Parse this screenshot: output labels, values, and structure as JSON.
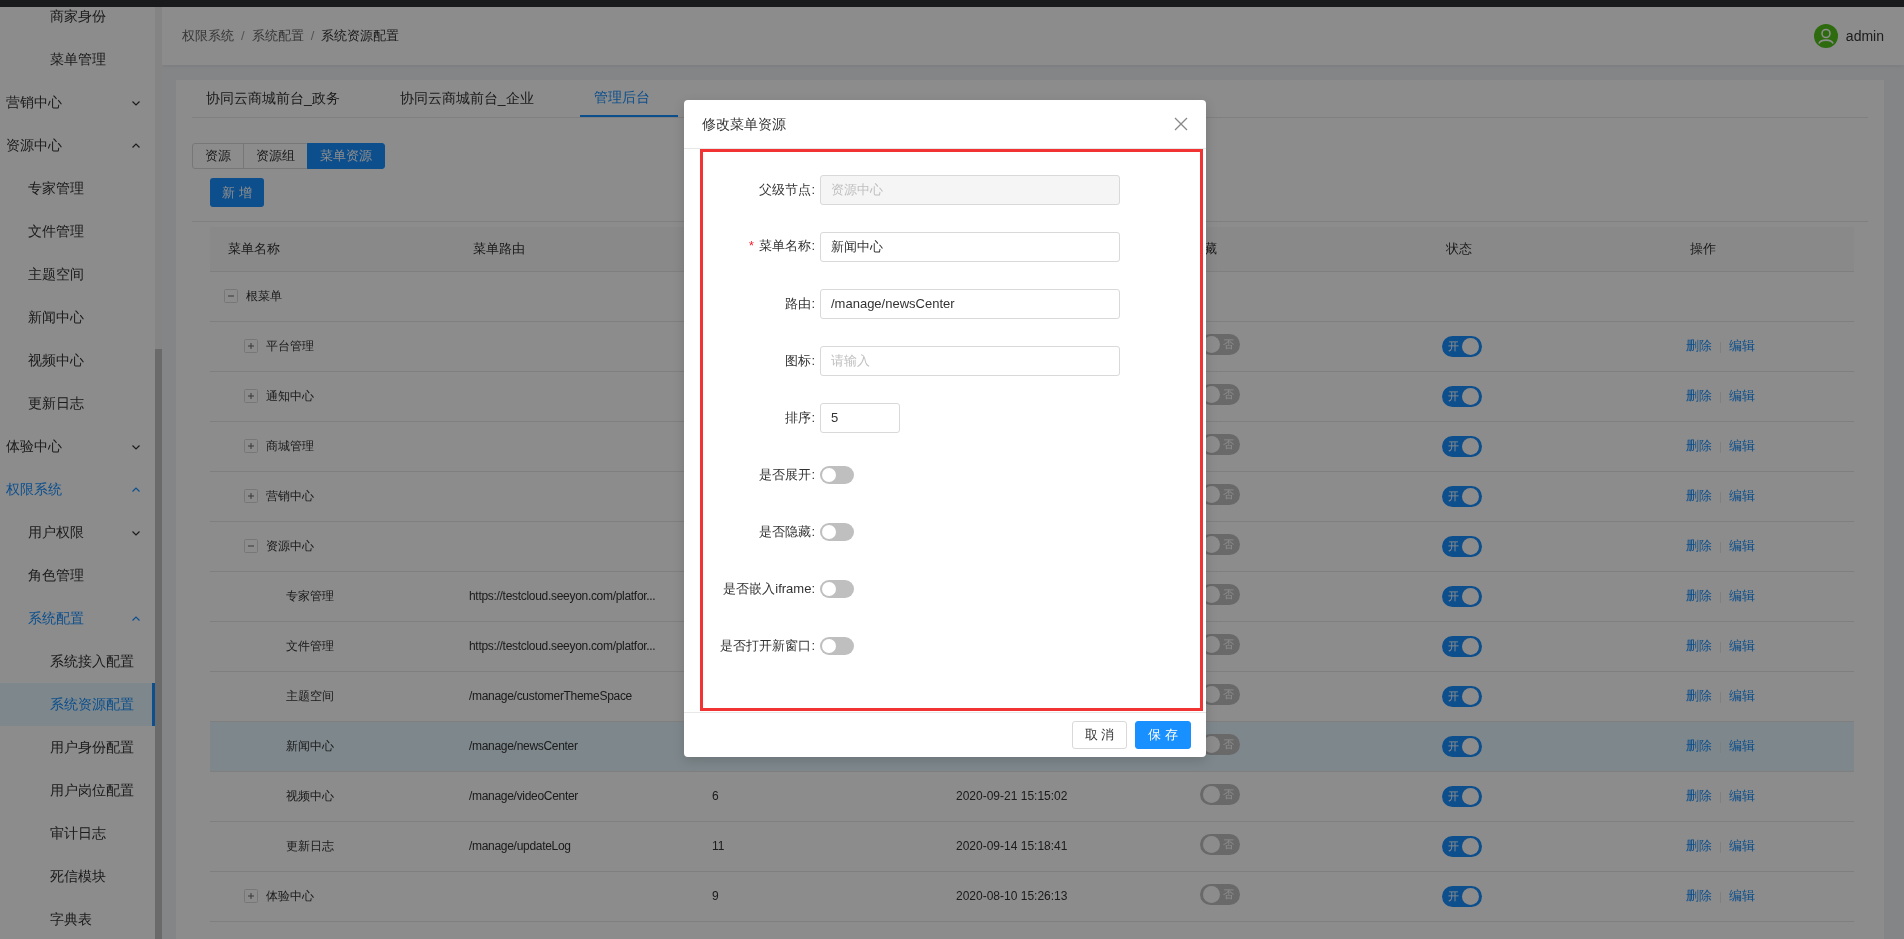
{
  "breadcrumb": {
    "items": [
      "权限系统",
      "系统配置",
      "系统资源配置"
    ],
    "separator": "/"
  },
  "user": {
    "name": "admin"
  },
  "sidebar": {
    "partial_items": [
      {
        "label": "商家身份",
        "selected": false
      },
      {
        "label": "菜单管理",
        "selected": false
      }
    ],
    "items": [
      {
        "label": "营销中心",
        "expanded": false,
        "selected": false
      },
      {
        "label": "资源中心",
        "expanded": true,
        "selected": false,
        "children": [
          {
            "label": "专家管理",
            "selected": false
          },
          {
            "label": "文件管理",
            "selected": false
          },
          {
            "label": "主题空间",
            "selected": false
          },
          {
            "label": "新闻中心",
            "selected": false
          },
          {
            "label": "视频中心",
            "selected": false
          },
          {
            "label": "更新日志",
            "selected": false
          }
        ]
      },
      {
        "label": "体验中心",
        "expanded": false,
        "selected": false
      },
      {
        "label": "权限系统",
        "expanded": true,
        "selected": false,
        "children": [
          {
            "label": "用户权限",
            "expanded": false,
            "selected": false
          },
          {
            "label": "角色管理",
            "selected": false
          },
          {
            "label": "系统配置",
            "expanded": true,
            "selected": false,
            "children": [
              {
                "label": "系统接入配置",
                "selected": false
              },
              {
                "label": "系统资源配置",
                "selected": true
              },
              {
                "label": "用户身份配置",
                "selected": false
              },
              {
                "label": "用户岗位配置",
                "selected": false
              },
              {
                "label": "审计日志",
                "selected": false
              },
              {
                "label": "死信模块",
                "selected": false
              },
              {
                "label": "字典表",
                "selected": false
              }
            ]
          }
        ]
      }
    ]
  },
  "tabs": [
    {
      "label": "协同云商城前台_政务",
      "selected": false
    },
    {
      "label": "协同云商城前台_企业",
      "selected": false
    },
    {
      "label": "管理后台",
      "selected": true
    }
  ],
  "segments": [
    {
      "label": "资源",
      "selected": false
    },
    {
      "label": "资源组",
      "selected": false
    },
    {
      "label": "菜单资源",
      "selected": true
    }
  ],
  "add_button": "新 增",
  "table": {
    "columns": [
      "菜单名称",
      "菜单路由",
      null,
      null,
      "藏",
      "状态",
      "操作"
    ],
    "rows": [
      {
        "name": "根菜单",
        "expanded": true,
        "selected": false,
        "children": [
          {
            "name": "平台管理",
            "expanded": false,
            "selected": false,
            "hidden": {
              "on": false,
              "label": "否"
            },
            "status": {
              "on": true,
              "label": "开"
            },
            "actions": [
              "删除",
              "编辑"
            ]
          },
          {
            "name": "通知中心",
            "expanded": false,
            "selected": false,
            "hidden": {
              "on": false,
              "label": "否"
            },
            "status": {
              "on": true,
              "label": "开"
            },
            "actions": [
              "删除",
              "编辑"
            ]
          },
          {
            "name": "商城管理",
            "expanded": false,
            "selected": false,
            "hidden": {
              "on": false,
              "label": "否"
            },
            "status": {
              "on": true,
              "label": "开"
            },
            "actions": [
              "删除",
              "编辑"
            ]
          },
          {
            "name": "营销中心",
            "expanded": false,
            "selected": false,
            "hidden": {
              "on": false,
              "label": "否"
            },
            "status": {
              "on": true,
              "label": "开"
            },
            "actions": [
              "删除",
              "编辑"
            ]
          },
          {
            "name": "资源中心",
            "expanded": true,
            "selected": false,
            "hidden": {
              "on": false,
              "label": "否"
            },
            "status": {
              "on": true,
              "label": "开"
            },
            "actions": [
              "删除",
              "编辑"
            ],
            "children": [
              {
                "name": "专家管理",
                "route": "https://testcloud.seeyon.com/platfor...",
                "selected": false,
                "hidden": {
                  "on": false,
                  "label": "否"
                },
                "status": {
                  "on": true,
                  "label": "开"
                },
                "actions": [
                  "删除",
                  "编辑"
                ]
              },
              {
                "name": "文件管理",
                "route": "https://testcloud.seeyon.com/platfor...",
                "selected": false,
                "hidden": {
                  "on": false,
                  "label": "否"
                },
                "status": {
                  "on": true,
                  "label": "开"
                },
                "actions": [
                  "删除",
                  "编辑"
                ]
              },
              {
                "name": "主题空间",
                "route": "/manage/customerThemeSpace",
                "selected": false,
                "hidden": {
                  "on": false,
                  "label": "否"
                },
                "status": {
                  "on": true,
                  "label": "开"
                },
                "actions": [
                  "删除",
                  "编辑"
                ]
              },
              {
                "name": "新闻中心",
                "route": "/manage/newsCenter",
                "selected": true,
                "hidden": {
                  "on": false,
                  "label": "否"
                },
                "status": {
                  "on": true,
                  "label": "开"
                },
                "actions": [
                  "删除",
                  "编辑"
                ]
              },
              {
                "name": "视频中心",
                "route": "/manage/videoCenter",
                "sort": "6",
                "time": "2020-09-21 15:15:02",
                "selected": false,
                "hidden": {
                  "on": false,
                  "label": "否"
                },
                "status": {
                  "on": true,
                  "label": "开"
                },
                "actions": [
                  "删除",
                  "编辑"
                ]
              },
              {
                "name": "更新日志",
                "route": "/manage/updateLog",
                "sort": "11",
                "time": "2020-09-14 15:18:41",
                "selected": false,
                "hidden": {
                  "on": false,
                  "label": "否"
                },
                "status": {
                  "on": true,
                  "label": "开"
                },
                "actions": [
                  "删除",
                  "编辑"
                ]
              }
            ]
          },
          {
            "name": "体验中心",
            "sort": "9",
            "time": "2020-08-10 15:26:13",
            "expanded": false,
            "selected": false,
            "hidden": {
              "on": false,
              "label": "否"
            },
            "status": {
              "on": true,
              "label": "开"
            },
            "actions": [
              "删除",
              "编辑"
            ]
          }
        ]
      }
    ]
  },
  "dialog": {
    "title": "修改菜单资源",
    "fields": [
      {
        "kind": "text",
        "label": "父级节点:",
        "value": "资源中心",
        "disabled": true
      },
      {
        "kind": "text",
        "label": "菜单名称:",
        "required_mark": "*",
        "value": "新闻中心"
      },
      {
        "kind": "text",
        "label": "路由:",
        "value": "/manage/newsCenter"
      },
      {
        "kind": "text",
        "label": "图标:",
        "placeholder": "请输入"
      },
      {
        "kind": "number",
        "label": "排序:",
        "value": "5"
      },
      {
        "kind": "switch",
        "label": "是否展开:",
        "on": false
      },
      {
        "kind": "switch",
        "label": "是否隐藏:",
        "on": false
      },
      {
        "kind": "switch",
        "label": "是否嵌入iframe:",
        "on": false
      },
      {
        "kind": "switch",
        "label": "是否打开新窗口:",
        "on": false
      }
    ],
    "buttons": [
      {
        "label": "取 消",
        "kind": "default"
      },
      {
        "label": "保 存",
        "kind": "primary"
      }
    ]
  }
}
